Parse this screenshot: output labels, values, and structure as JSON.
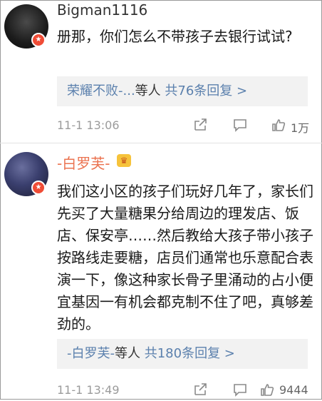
{
  "comments": [
    {
      "username": "Bigman1116",
      "text": "册那，你们怎么不带孩子去银行试试?",
      "reply_user": "荣耀不败-...",
      "reply_middle": "等人",
      "reply_link": "共76条回复 >",
      "timestamp": "11-1 13:06",
      "like_count": "1万"
    },
    {
      "username": "-白罗芙-",
      "text": "我们这小区的孩子们玩好几年了，家长们先买了大量糖果分给周边的理发店、饭店、保安亭……然后教给大孩子带小孩子按路线走要糖，店员们通常也乐意配合表演一下，像这种家长骨子里涌动的占小便宜基因一有机会都克制不住了吧，真够差劲的。",
      "reply_user": "-白罗芙-",
      "reply_middle": "等人",
      "reply_link": "共180条回复 >",
      "timestamp": "11-1 13:49",
      "like_count": "9444"
    }
  ],
  "icons": {
    "share": "share-icon",
    "comment": "comment-icon",
    "like": "like-icon"
  },
  "colors": {
    "link": "#5b80ad",
    "username_member": "#eb7350"
  }
}
